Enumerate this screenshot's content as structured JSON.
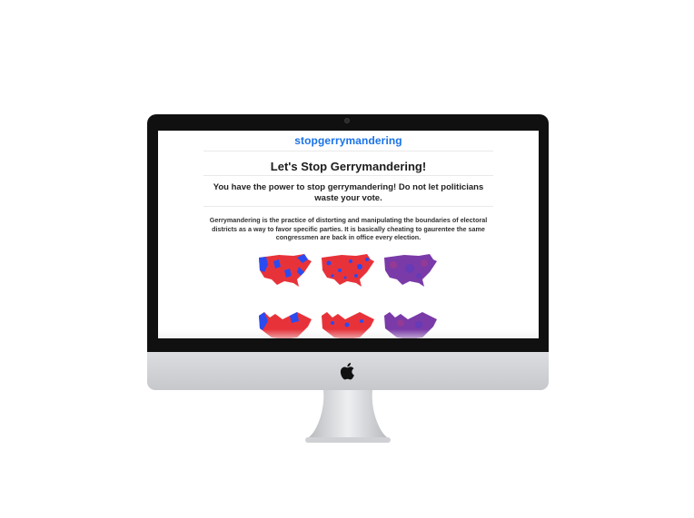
{
  "site": {
    "logo_text": "stopgerrymandering",
    "title": "Let's Stop Gerrymandering!",
    "subtitle": "You have the power to stop gerrymandering! Do not let politicians waste your vote.",
    "description": "Gerrymandering is the practice of distorting and manipulating the boundaries of electoral districts as a way to favor specific parties. It is basically cheating to gaurentee the same congressmen are back in office every election."
  },
  "colors": {
    "brand_blue": "#1a73e8",
    "map_red": "#e8323a",
    "map_blue": "#2a4bf0",
    "map_purple": "#7a3aa8"
  },
  "icons": {
    "device_logo": "apple-icon"
  }
}
